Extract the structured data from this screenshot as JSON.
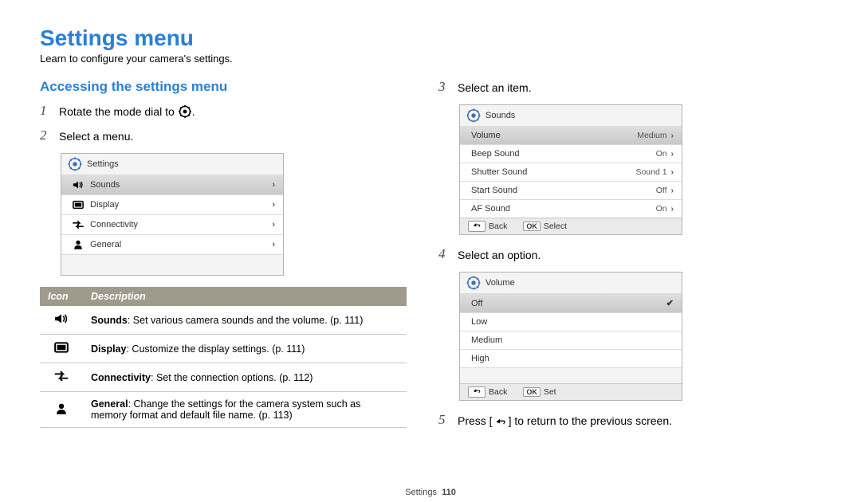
{
  "page": {
    "title": "Settings menu",
    "subtitle": "Learn to configure your camera's settings.",
    "footer_section": "Settings",
    "footer_page": "110"
  },
  "section": {
    "heading": "Accessing the settings menu"
  },
  "steps": {
    "s1_prefix": "Rotate the mode dial to ",
    "s1_suffix": ".",
    "s2": "Select a menu.",
    "s3": "Select an item.",
    "s4": "Select an option.",
    "s5_prefix": "Press [",
    "s5_suffix": "] to return to the previous screen."
  },
  "ui1": {
    "title": "Settings",
    "rows": [
      {
        "label": "Sounds"
      },
      {
        "label": "Display"
      },
      {
        "label": "Connectivity"
      },
      {
        "label": "General"
      }
    ]
  },
  "ui2": {
    "title": "Sounds",
    "rows": [
      {
        "label": "Volume",
        "value": "Medium"
      },
      {
        "label": "Beep Sound",
        "value": "On"
      },
      {
        "label": "Shutter Sound",
        "value": "Sound 1"
      },
      {
        "label": "Start Sound",
        "value": "Off"
      },
      {
        "label": "AF Sound",
        "value": "On"
      }
    ],
    "back": "Back",
    "ok": "Select"
  },
  "ui3": {
    "title": "Volume",
    "rows": [
      {
        "label": "Off"
      },
      {
        "label": "Low"
      },
      {
        "label": "Medium"
      },
      {
        "label": "High"
      }
    ],
    "back": "Back",
    "ok": "Set"
  },
  "table": {
    "head_icon": "Icon",
    "head_desc": "Description",
    "rows": [
      {
        "bold": "Sounds",
        "rest": ": Set various camera sounds and the volume. (p. 111)"
      },
      {
        "bold": "Display",
        "rest": ": Customize the display settings. (p. 111)"
      },
      {
        "bold": "Connectivity",
        "rest": ": Set the connection options. (p. 112)"
      },
      {
        "bold": "General",
        "rest": ": Change the settings for the camera system such as memory format and default file name. (p. 113)"
      }
    ]
  }
}
